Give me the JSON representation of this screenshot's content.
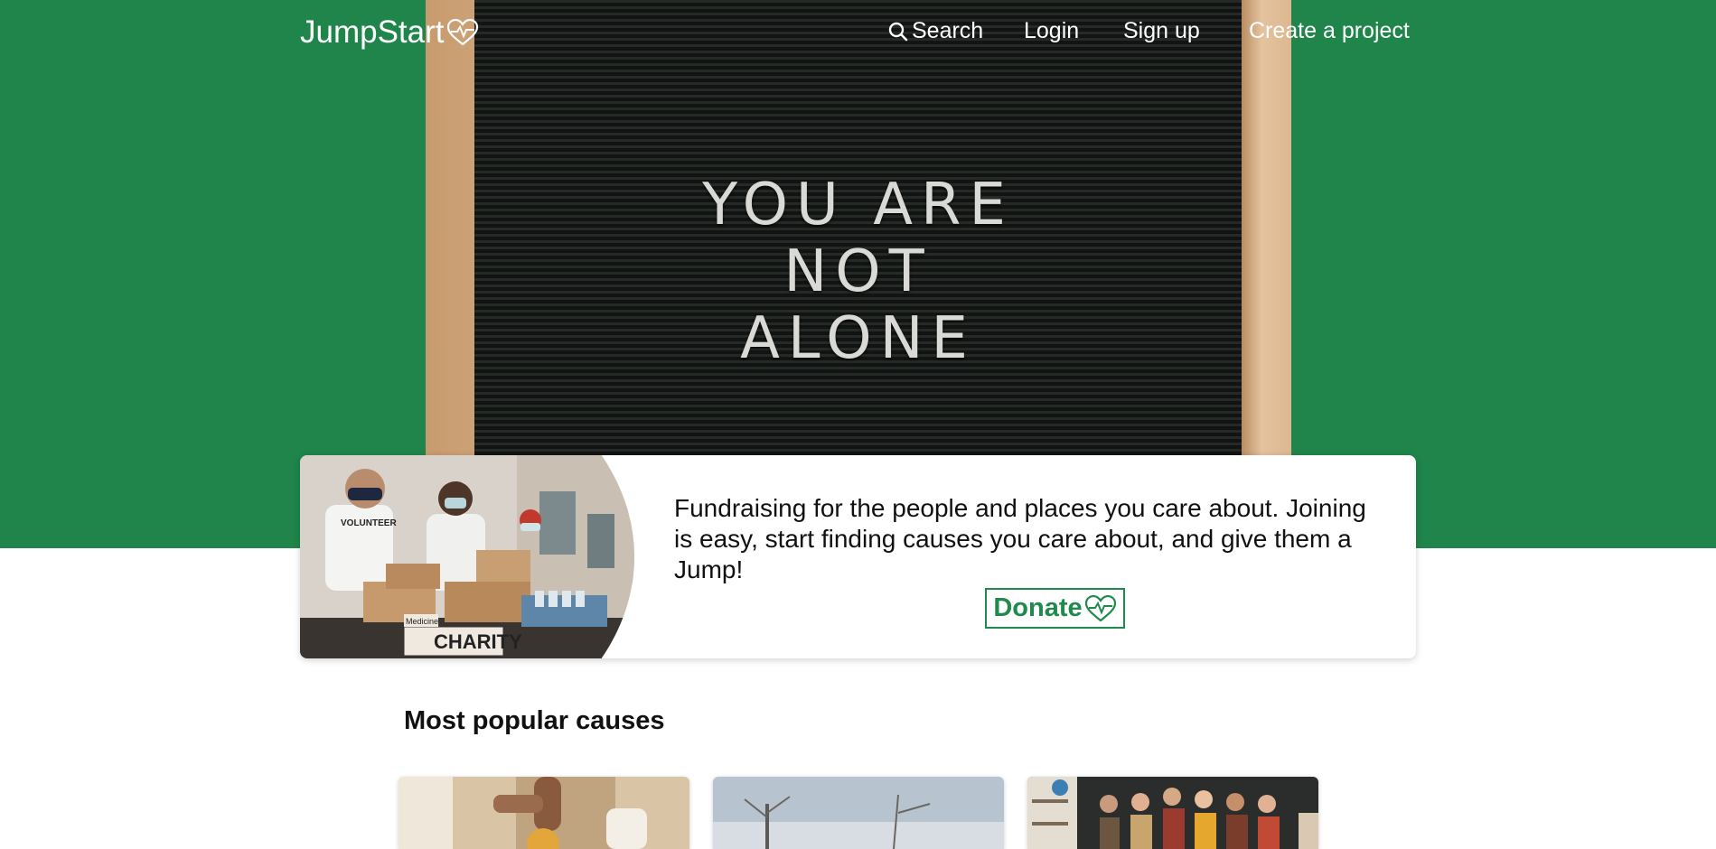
{
  "brand": {
    "name": "JumpStart",
    "accent": "#1f854a"
  },
  "nav": {
    "search_label": "Search",
    "login_label": "Login",
    "signup_label": "Sign up",
    "create_label": "Create a project"
  },
  "hero_photo": {
    "board_text": "YOU ARE\nNOT\nALONE"
  },
  "promo": {
    "text": "Fundraising for the people and places you care about. Joining is easy, start finding causes you care about, and give them a Jump!",
    "donate_label": "Donate",
    "photo_signs": {
      "charity": "CHARITY",
      "medicine": "Medicine",
      "shirt": "VOLUNTEER"
    }
  },
  "popular": {
    "title": "Most popular causes",
    "cards": [
      {
        "photo": "hands-food-photo"
      },
      {
        "photo": "winter-trees-photo"
      },
      {
        "photo": "classroom-students-photo"
      }
    ]
  }
}
